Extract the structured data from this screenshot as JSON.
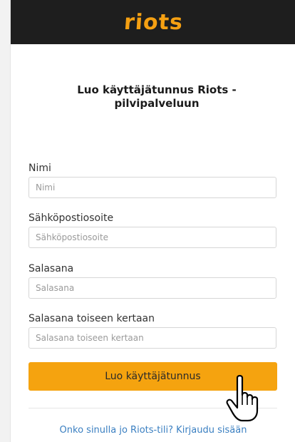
{
  "header": {
    "logo_text": "riots"
  },
  "form": {
    "title": "Luo käyttäjätunnus Riots - pilvipalveluun",
    "fields": [
      {
        "label": "Nimi",
        "placeholder": "Nimi",
        "value": ""
      },
      {
        "label": "Sähköpostiosoite",
        "placeholder": "Sähköpostiosoite",
        "value": ""
      },
      {
        "label": "Salasana",
        "placeholder": "Salasana",
        "value": ""
      },
      {
        "label": "Salasana toiseen kertaan",
        "placeholder": "Salasana toiseen kertaan",
        "value": ""
      }
    ],
    "submit_label": "Luo käyttäjätunnus",
    "login_prompt": "Onko sinulla jo Riots-tili? Kirjaudu sisään"
  },
  "colors": {
    "header_bg": "#1e1e1e",
    "brand_orange": "#f5a012",
    "button_bg": "#f5a30f",
    "link_blue": "#3a7fc1"
  },
  "icons": {
    "logo": "riots-logo",
    "pointer": "hand-pointer-icon"
  }
}
